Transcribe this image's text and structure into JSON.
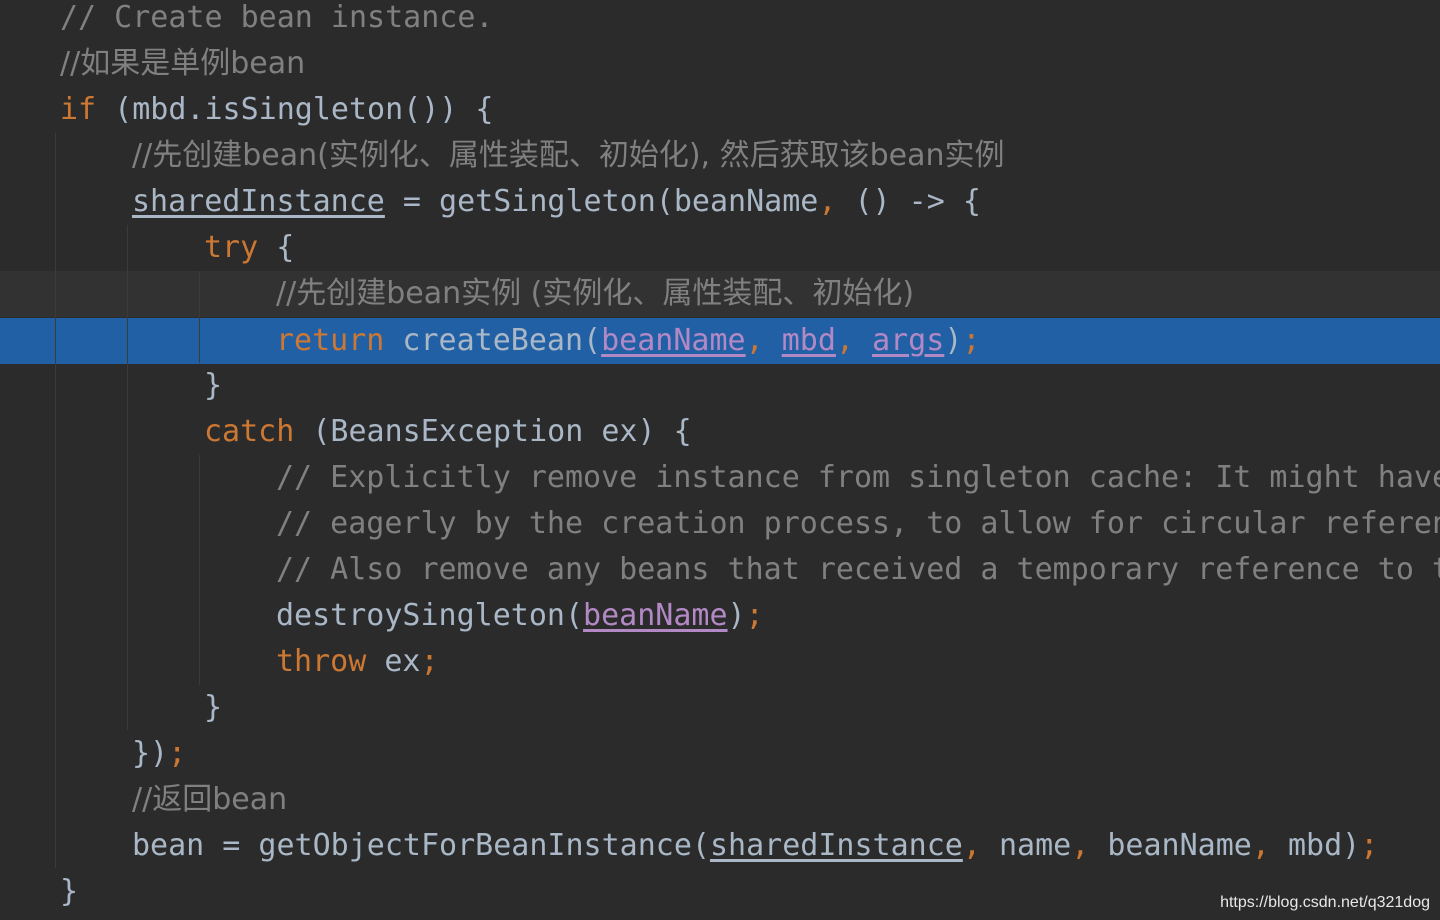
{
  "lines": {
    "l1": "// Create bean instance.",
    "l2": "//如果是单例bean",
    "l3_kw": "if",
    "l3_rest": " (mbd.isSingleton()) {",
    "l4": "//先创建bean(实例化、属性装配、初始化), 然后获取该bean实例",
    "l5_field": "sharedInstance",
    "l5_a": " = getSingleton(beanName",
    "l5_comma": ",",
    "l5_b": " () -> {",
    "l6_kw": "try",
    "l6_rest": " {",
    "l7": "//先创建bean实例 (实例化、属性装配、初始化)",
    "l8_kw": "return",
    "l8_a": " createBean(",
    "l8_p1": "beanName",
    "l8_c1": ",",
    "l8_p2": "mbd",
    "l8_c2": ",",
    "l8_p3": "args",
    "l8_close": ")",
    "l8_semi": ";",
    "l9": "}",
    "l10_kw": "catch",
    "l10_rest": " (BeansException ex) {",
    "l11": "// Explicitly remove instance from singleton cache: It might have",
    "l12": "// eagerly by the creation process, to allow for circular referen",
    "l13": "// Also remove any beans that received a temporary reference to t",
    "l14_a": "destroySingleton(",
    "l14_p": "beanName",
    "l14_close": ")",
    "l14_semi": ";",
    "l15_kw": "throw",
    "l15_rest": " ex",
    "l15_semi": ";",
    "l16": "}",
    "l17_a": "})",
    "l17_semi": ";",
    "l18": "//返回bean",
    "l19_a": "bean = getObjectForBeanInstance(",
    "l19_field": "sharedInstance",
    "l19_c1": ",",
    "l19_b": " name",
    "l19_c2": ",",
    "l19_c": " beanName",
    "l19_c3": ",",
    "l19_d": " mbd)",
    "l19_semi": ";",
    "l20": "}"
  },
  "watermark": "https://blog.csdn.net/q321dog",
  "colors": {
    "background": "#2b2b2b",
    "keyword": "#cc7832",
    "comment": "#808080",
    "text": "#a9b7c6",
    "parameter": "#b389c5",
    "selection": "#2160a5"
  }
}
